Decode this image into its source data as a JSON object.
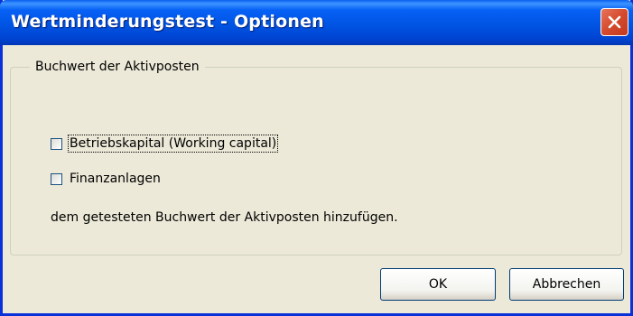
{
  "window": {
    "title": "Wertminderungstest - Optionen"
  },
  "group": {
    "legend": "Buchwert der Aktivposten",
    "options": [
      {
        "label": "Betriebskapital (Working capital)",
        "checked": false,
        "focused": true
      },
      {
        "label": "Finanzanlagen",
        "checked": false,
        "focused": false
      }
    ],
    "info": "dem getesteten Buchwert der Aktivposten hinzufügen."
  },
  "buttons": {
    "ok": "OK",
    "cancel": "Abbrechen"
  },
  "colors": {
    "titlebar": "#0054e3",
    "dialog_bg": "#ece9d8",
    "close_button": "#d54a2d",
    "button_border": "#003c74"
  },
  "icons": {
    "close": "close-icon"
  }
}
